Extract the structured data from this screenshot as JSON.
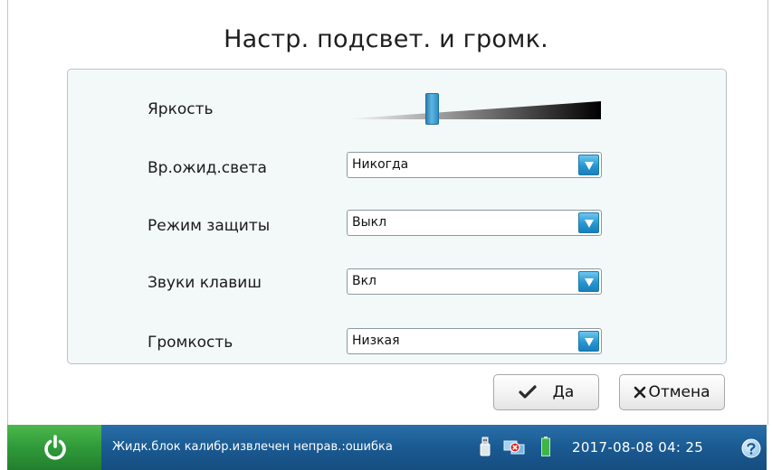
{
  "dialog": {
    "title": "Настр. подсвет. и громк."
  },
  "settings": {
    "brightness": {
      "label": "Яркость",
      "level": 0.31
    },
    "backlight_timeout": {
      "label": "Вр.ожид.света",
      "value": "Никогда"
    },
    "protection_mode": {
      "label": "Режим защиты",
      "value": "Выкл"
    },
    "key_sounds": {
      "label": "Звуки клавиш",
      "value": "Вкл"
    },
    "volume": {
      "label": "Громкость",
      "value": "Низкая"
    }
  },
  "buttons": {
    "ok_label": "Да",
    "cancel_label": "Отмена"
  },
  "status_bar": {
    "message": "Жидк.блок калибр.извлечен неправ.:ошибка",
    "datetime": "2017-08-08  04: 25",
    "icons": [
      "usb-icon",
      "network-error-icon",
      "battery-icon",
      "help-icon"
    ]
  },
  "colors": {
    "status_bar": "#1a5a92",
    "power_button": "#2f9a3a",
    "accent": "#2596d3"
  }
}
